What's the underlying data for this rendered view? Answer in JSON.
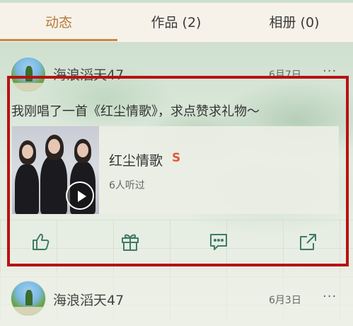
{
  "tabs": [
    {
      "label": "动态",
      "active": true
    },
    {
      "label": "作品 (2)",
      "active": false
    },
    {
      "label": "相册 (0)",
      "active": false
    }
  ],
  "posts": [
    {
      "username": "海浪滔天47",
      "date": "6月7日",
      "more": "···",
      "text": "我刚唱了一首《红尘情歌》，求点赞求礼物～",
      "song": {
        "title": "红尘情歌",
        "badge": "S",
        "listeners": "6人听过"
      },
      "actions": [
        "like-icon",
        "gift-icon",
        "comment-icon",
        "share-icon"
      ]
    },
    {
      "username": "海浪滔天47",
      "date": "6月3日",
      "more": "···"
    }
  ],
  "colors": {
    "accent": "#c58947",
    "highlight": "#b81212",
    "icon": "#3f7b66",
    "badge": "#e0593a"
  }
}
